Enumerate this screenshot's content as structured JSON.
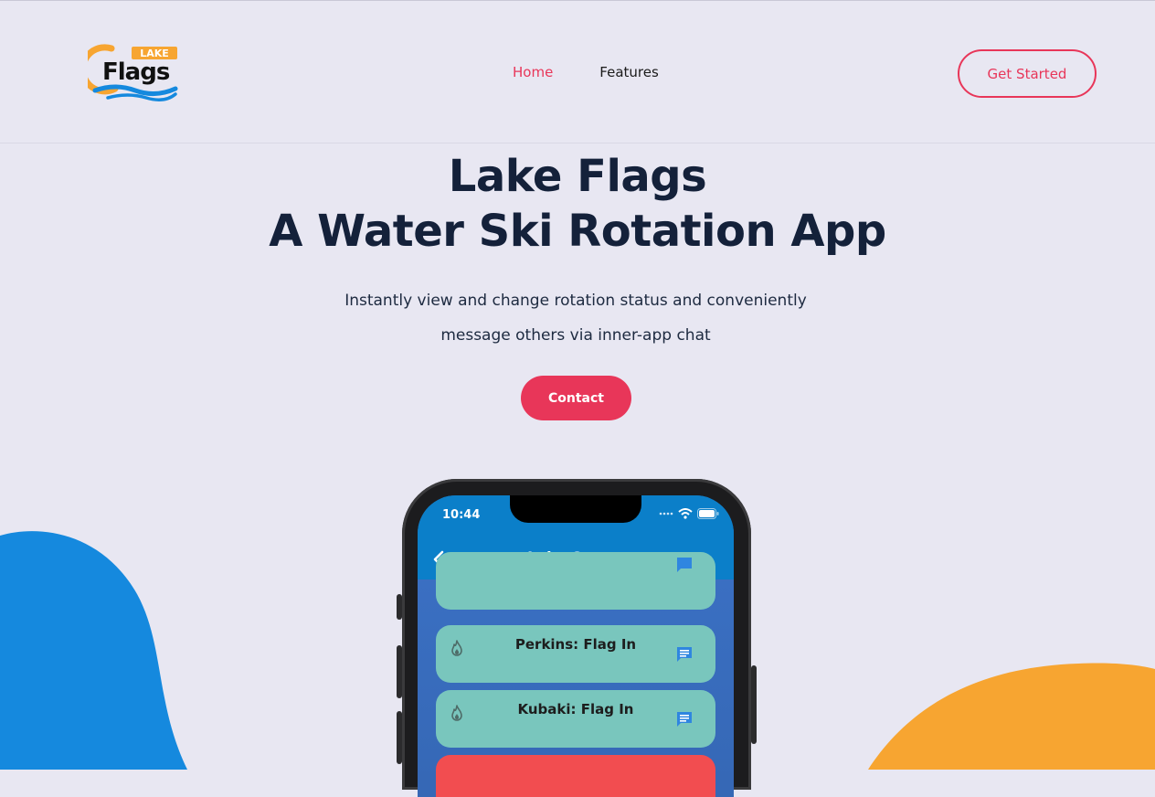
{
  "brand": {
    "logo_small_text": "LAKE",
    "logo_main_text": "Flags"
  },
  "nav": {
    "items": [
      {
        "label": "Home",
        "active": true
      },
      {
        "label": "Features",
        "active": false
      }
    ],
    "cta_label": "Get Started"
  },
  "hero": {
    "title_line1": "Lake Flags",
    "title_line2": "A Water Ski Rotation App",
    "subtitle_line1": "Instantly view and change rotation status and conveniently",
    "subtitle_line2": "message others via inner-app chat",
    "contact_label": "Contact"
  },
  "phone": {
    "time": "10:44",
    "app_title": "Lake Queue",
    "queue": [
      {
        "name": "Perkins",
        "status": "Flag In",
        "label": "Perkins:  Flag In"
      },
      {
        "name": "Kubaki",
        "status": "Flag In",
        "label": "Kubaki:  Flag In"
      }
    ]
  },
  "colors": {
    "accent": "#e83659",
    "background": "#e8e7f2",
    "heading": "#14213a",
    "app_bar": "#0b7fc9",
    "card": "#79c6bd",
    "card_alert": "#f24d50",
    "blob_blue": "#1589de",
    "blob_orange": "#f7a531"
  },
  "icons": {
    "back": "chevron-left-icon",
    "flame": "flame-icon",
    "chat": "chat-bubble-icon",
    "wifi": "wifi-icon",
    "battery": "battery-icon",
    "signal": "signal-icon"
  }
}
